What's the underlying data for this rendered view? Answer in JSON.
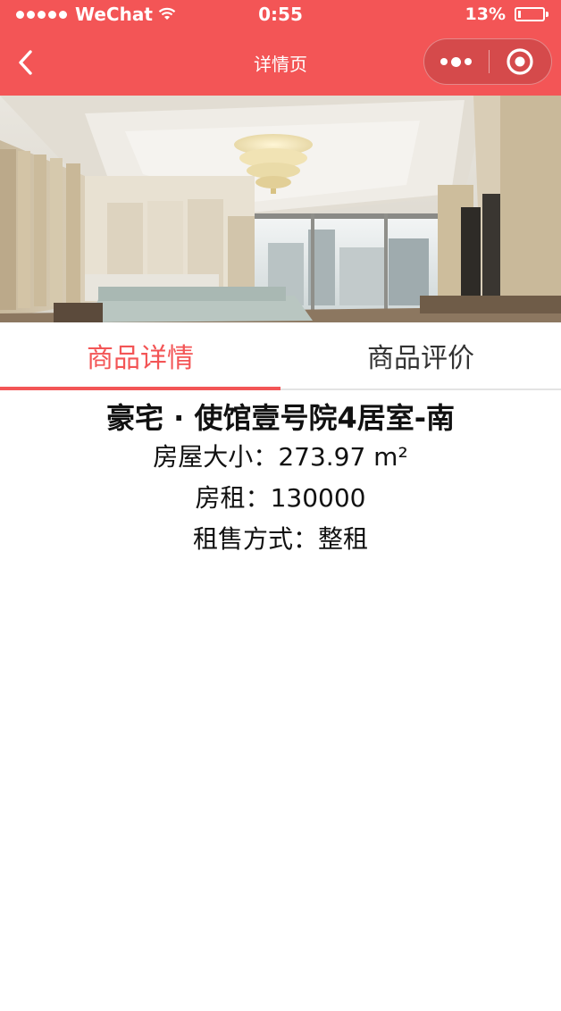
{
  "status_bar": {
    "carrier": "WeChat",
    "time": "0:55",
    "battery_percent": "13%",
    "battery_level": 0.13,
    "signal_dots": 5
  },
  "nav": {
    "title": "详情页",
    "back_icon": "chevron-left-icon",
    "more_icon": "more-dots-icon",
    "close_icon": "target-circle-icon"
  },
  "hero": {
    "image_description_icon": "bedroom-photo"
  },
  "tabs": [
    {
      "label": "商品详情",
      "active": true
    },
    {
      "label": "商品评价",
      "active": false
    }
  ],
  "details": {
    "title": "豪宅 · 使馆壹号院4居室-南",
    "size_label": "房屋大小：",
    "size_value": "273.97 m²",
    "rent_label": "房租：",
    "rent_value": "130000",
    "rent_type_label": "租售方式：",
    "rent_type_value": "整租"
  },
  "colors": {
    "accent": "#f35556",
    "text": "#111111",
    "tab_inactive": "#333333"
  }
}
